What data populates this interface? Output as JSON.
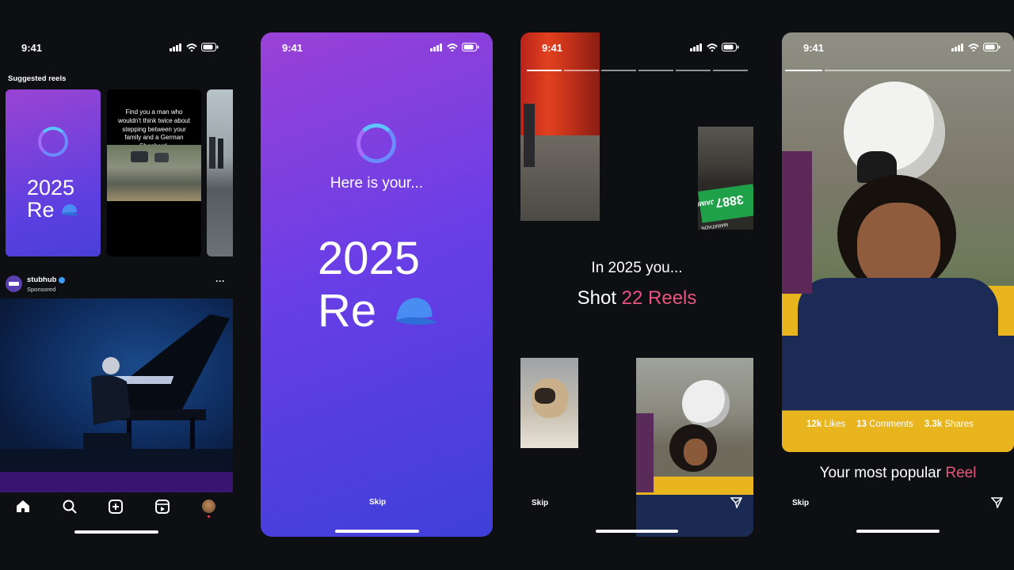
{
  "status": {
    "time": "9:41"
  },
  "phone1": {
    "section_title": "Suggested reels",
    "recap_card": {
      "year": "2025",
      "word": "Re"
    },
    "meme_card": {
      "caption": "Find you a man who wouldn't think twice about stepping between your family and a German Shepherd."
    },
    "post": {
      "account": "stubhub",
      "sponsored": "Sponsored",
      "more": "···"
    },
    "nav": [
      "home-icon",
      "search-icon",
      "create-icon",
      "reels-icon",
      "profile-icon"
    ]
  },
  "phone2": {
    "intro": "Here is your...",
    "year": "2025",
    "word": "Re",
    "emoji": "cap",
    "skip": "Skip"
  },
  "phone3": {
    "line1": "In 2025 you...",
    "line2_prefix": "Shot ",
    "line2_highlight": "22 Reels",
    "bib_text": "3887",
    "bib_name": "JAIME",
    "bib_event": "MARATHON",
    "skip": "Skip"
  },
  "phone4": {
    "stats": [
      {
        "value": "12k",
        "label": "Likes"
      },
      {
        "value": "13",
        "label": "Comments"
      },
      {
        "value": "3.3k",
        "label": "Shares"
      }
    ],
    "caption_prefix": "Your most popular ",
    "caption_highlight": "Reel",
    "skip": "Skip"
  },
  "colors": {
    "highlight": "#e8557e",
    "ring_start": "#4fb3ff",
    "ring_end": "#8a5cf6"
  }
}
